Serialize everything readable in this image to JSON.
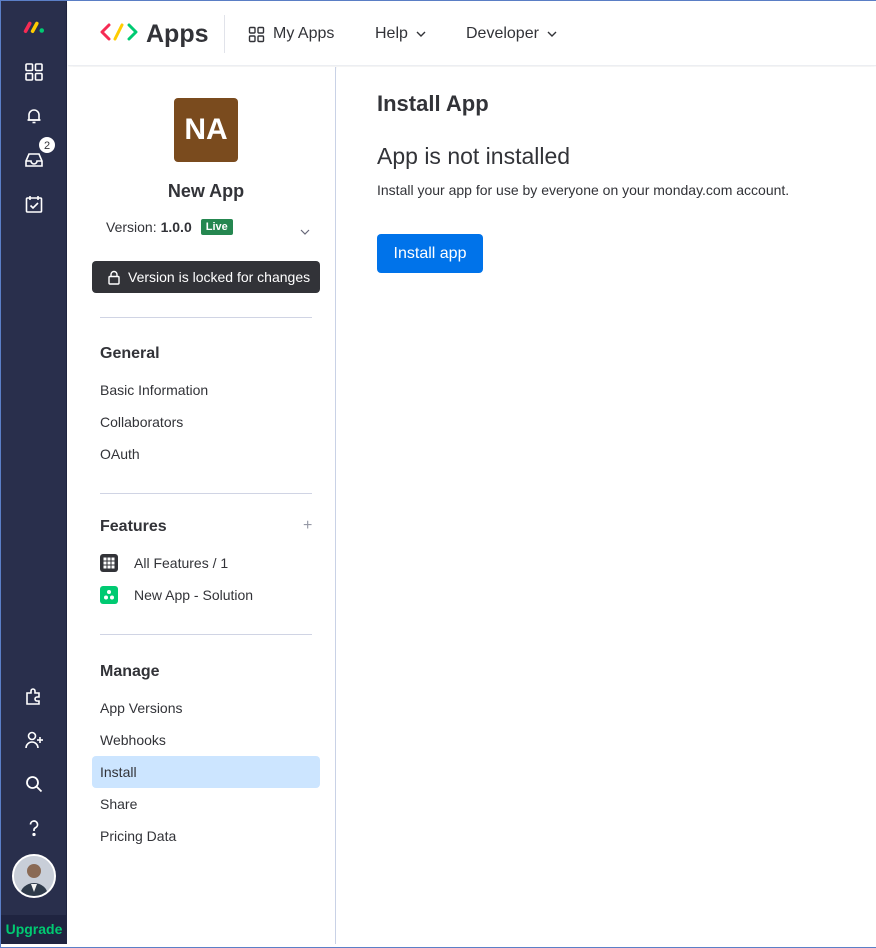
{
  "header": {
    "brand_title": "Apps",
    "nav": [
      {
        "label": "My Apps",
        "icon": "grid-icon"
      },
      {
        "label": "Help",
        "icon": "chevron-down-icon"
      },
      {
        "label": "Developer",
        "icon": "chevron-down-icon"
      }
    ]
  },
  "rail": {
    "notification_count": "2",
    "upgrade_label": "Upgrade",
    "icons": [
      "monday-logo-icon",
      "grid-icon",
      "bell-icon",
      "inbox-icon",
      "calendar-check-icon",
      "puzzle-icon",
      "add-user-icon",
      "search-icon",
      "help-icon"
    ]
  },
  "app": {
    "initials": "NA",
    "name": "New App",
    "version_label": "Version:",
    "version_number": "1.0.0",
    "status": "Live",
    "locked_message": "Version is locked for changes"
  },
  "sections": {
    "general": {
      "title": "General",
      "items": [
        "Basic Information",
        "Collaborators",
        "OAuth"
      ]
    },
    "features": {
      "title": "Features",
      "add_label": "+",
      "items": [
        "All Features / 1",
        "New App - Solution"
      ]
    },
    "manage": {
      "title": "Manage",
      "items": [
        "App Versions",
        "Webhooks",
        "Install",
        "Share",
        "Pricing Data"
      ],
      "active": "Install"
    }
  },
  "main": {
    "title": "Install App",
    "status_heading": "App is not installed",
    "description": "Install your app for use by everyone on your monday.com account.",
    "install_button": "Install app"
  },
  "colors": {
    "rail": "#292f4c",
    "primary": "#0073ea",
    "live": "#258750",
    "active_item": "#cce5ff",
    "upgrade": "#00ca72",
    "app_logo": "#7a4b1e"
  }
}
